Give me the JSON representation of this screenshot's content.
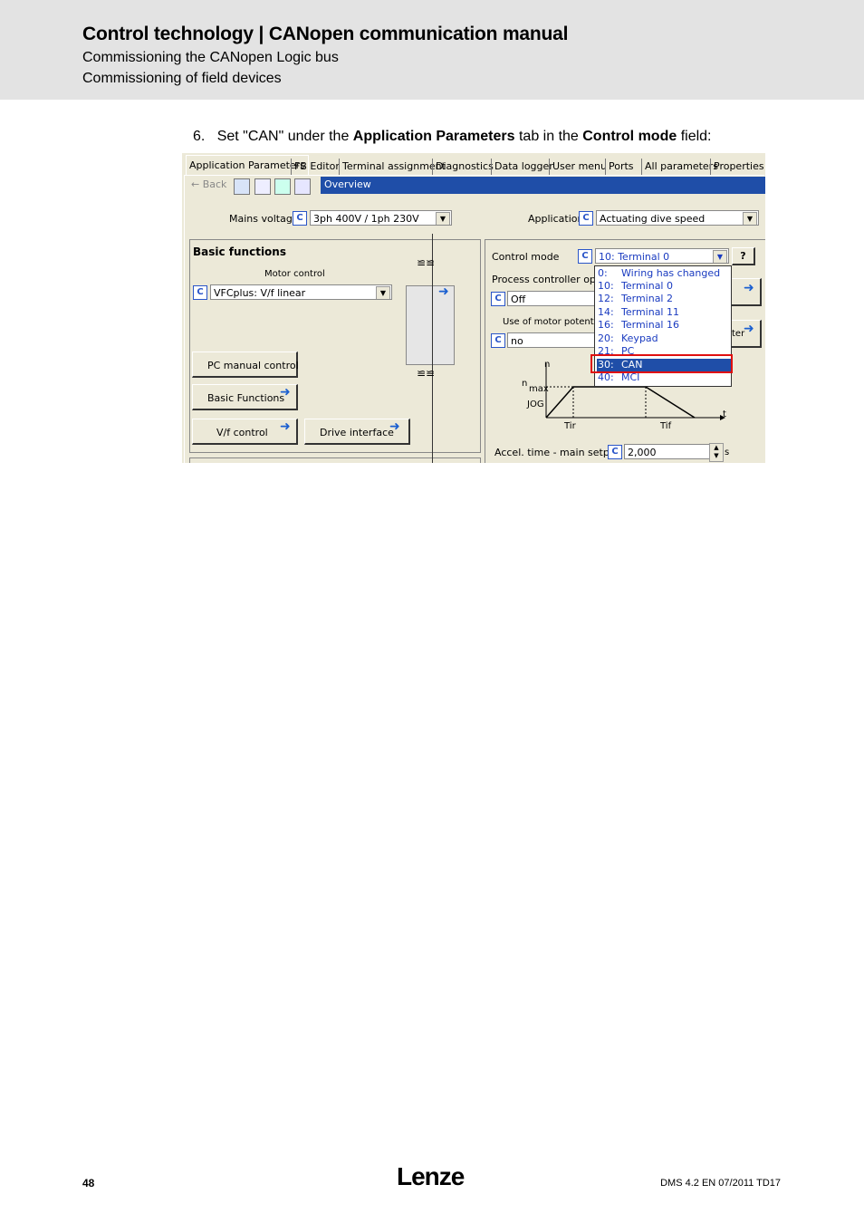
{
  "header": {
    "title": "Control technology | CANopen communication manual",
    "sub1": "Commissioning the CANopen Logic bus",
    "sub2": "Commissioning of field devices"
  },
  "step": {
    "number": "6.",
    "pre": "Set \"CAN\" under the ",
    "b1": "Application Parameters",
    "mid": " tab in the ",
    "b2": "Control mode",
    "post": " field:"
  },
  "screenshot": {
    "tabs": [
      "Application Parameters",
      "FB Editor",
      "Terminal assignment",
      "Diagnostics",
      "Data logger",
      "User menu",
      "Ports",
      "All parameters",
      "Properties"
    ],
    "back_label": "Back",
    "overview": "Overview",
    "mains_voltage_label": "Mains voltage",
    "mains_voltage_value": "3ph 400V / 1ph 230V",
    "application_label": "Application",
    "application_value": "Actuating dive speed",
    "c_label": "C",
    "basic_functions_title": "Basic functions",
    "motor_control_label": "Motor control",
    "motor_control_value": "VFCplus: V/f linear",
    "btn_pc_manual": "PC manual control",
    "btn_basic_functions": "Basic Functions",
    "btn_vf_control": "V/f control",
    "btn_drive_interface": "Drive interface",
    "control_mode_label": "Control mode",
    "control_mode_value": "10:  Terminal 0",
    "help_label": "?",
    "process_ctrl_label": "Process controller operati",
    "process_ctrl_value": "Off",
    "motor_pot_label": "Use of motor potentiom",
    "motor_pot_value": "no",
    "filter_partial": "ter",
    "graph_n": "n",
    "graph_nmax": "n",
    "graph_max": "max",
    "graph_jog": "JOG",
    "graph_tir": "Tir",
    "graph_tif": "Tif",
    "graph_t": "t",
    "accel_label": "Accel. time - main setp..",
    "accel_value": "2,000",
    "accel_unit": "s",
    "dropdown": [
      {
        "code": "0:",
        "text": "Wiring has changed"
      },
      {
        "code": "10:",
        "text": "Terminal 0"
      },
      {
        "code": "12:",
        "text": "Terminal 2"
      },
      {
        "code": "14:",
        "text": "Terminal 11"
      },
      {
        "code": "16:",
        "text": "Terminal 16"
      },
      {
        "code": "20:",
        "text": "Keypad"
      },
      {
        "code": "21:",
        "text": "PC"
      },
      {
        "code": "30:",
        "text": "CAN"
      },
      {
        "code": "40:",
        "text": "MCI"
      }
    ]
  },
  "footer": {
    "page": "48",
    "logo": "Lenze",
    "ref": "DMS 4.2 EN 07/2011 TD17"
  }
}
